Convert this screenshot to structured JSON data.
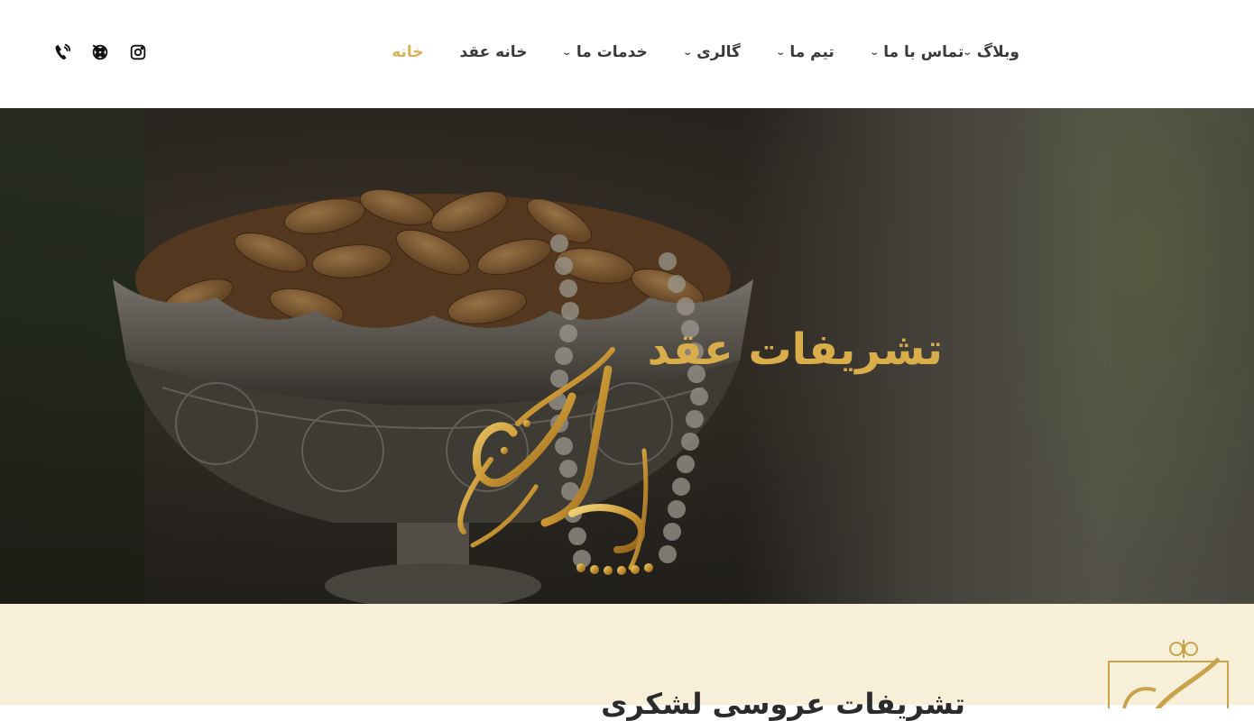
{
  "nav": {
    "items": [
      {
        "label": "خانه",
        "active": true,
        "has_dropdown": false
      },
      {
        "label": "خانه عقد",
        "active": false,
        "has_dropdown": false
      },
      {
        "label": "خدمات ما",
        "active": false,
        "has_dropdown": true
      },
      {
        "label": "گالری",
        "active": false,
        "has_dropdown": true
      },
      {
        "label": "تیم ما",
        "active": false,
        "has_dropdown": true
      },
      {
        "label": "تماس با ما",
        "active": false,
        "has_dropdown": true
      },
      {
        "label": "وبلاگ",
        "active": false,
        "has_dropdown": true
      }
    ],
    "active_color": "#d7b25a",
    "text_color": "#3a3a3a"
  },
  "social": [
    {
      "icon": "phone-icon"
    },
    {
      "icon": "film-reel-icon"
    },
    {
      "icon": "instagram-icon"
    }
  ],
  "hero": {
    "title": "تشریفات عقد",
    "title_color": "#d9ad4a",
    "slider_progress_percent": 60.6
  },
  "cream_section": {
    "title": "تشریفات عروسی لشکری",
    "background": "#f7efd8"
  }
}
